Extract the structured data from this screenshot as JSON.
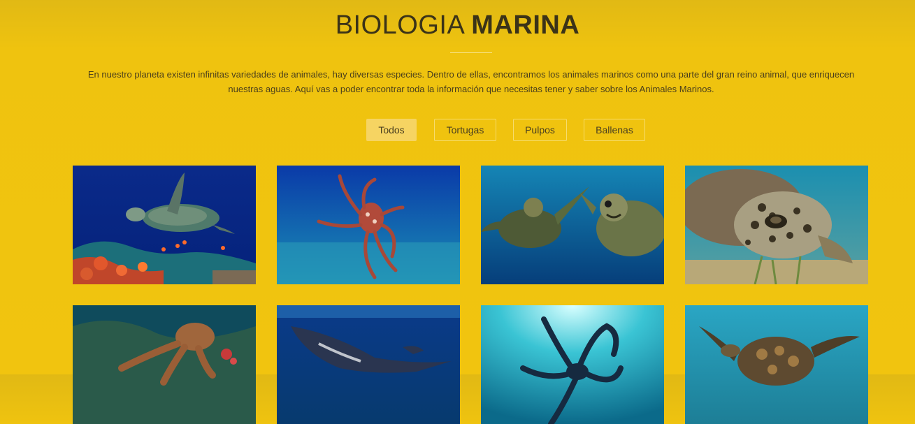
{
  "header": {
    "title_light": "BIOLOGIA",
    "title_bold": "MARINA",
    "intro_line1": "En nuestro planeta existen infinitas variedades de animales, hay diversas especies. Dentro de ellas, encontramos los animales marinos como una parte del gran reino animal, que enriquecen",
    "intro_line2": "nuestras aguas. Aquí vas a poder encontrar toda la información que necesitas tener y saber sobre los Animales Marinos."
  },
  "filters": [
    {
      "label": "Todos",
      "active": true
    },
    {
      "label": "Tortugas",
      "active": false
    },
    {
      "label": "Pulpos",
      "active": false
    },
    {
      "label": "Ballenas",
      "active": false
    }
  ],
  "gallery": [
    {
      "subject": "sea-turtle-over-reef",
      "category": "Tortugas"
    },
    {
      "subject": "octopus-swimming",
      "category": "Pulpos"
    },
    {
      "subject": "two-sea-turtles",
      "category": "Tortugas"
    },
    {
      "subject": "sea-turtle-closeup",
      "category": "Tortugas"
    },
    {
      "subject": "octopus-on-reef",
      "category": "Pulpos"
    },
    {
      "subject": "humpback-whale",
      "category": "Ballenas"
    },
    {
      "subject": "octopus-silhouette",
      "category": "Pulpos"
    },
    {
      "subject": "hawksbill-turtle",
      "category": "Tortugas"
    }
  ],
  "colors": {
    "background": "#f1c40f",
    "title_text": "#3b3318",
    "filter_active": "#f6d462"
  }
}
